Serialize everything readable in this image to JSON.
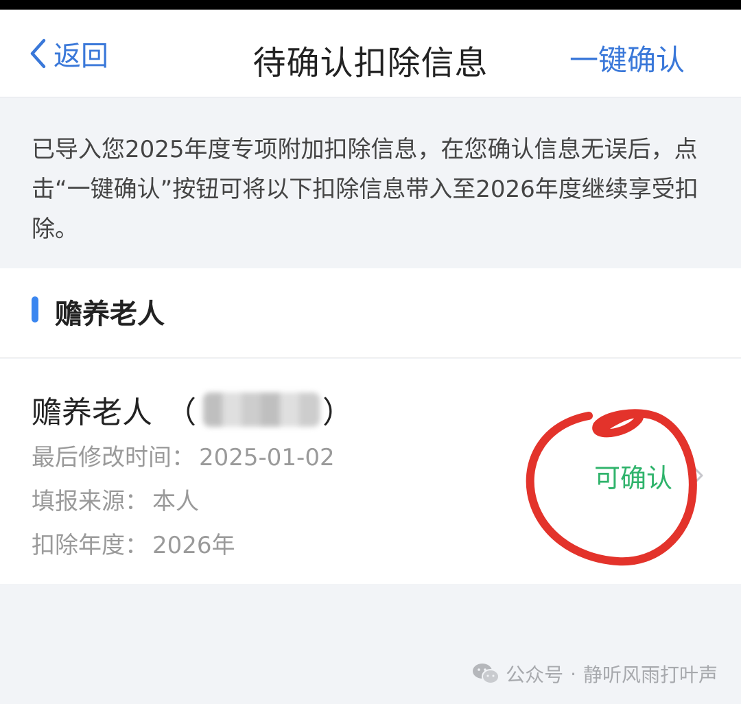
{
  "nav": {
    "back_label": "返回",
    "title": "待确认扣除信息",
    "confirm_all_label": "一键确认",
    "accent_color": "#3a78d9"
  },
  "notice": {
    "text": "已导入您2025年度专项附加扣除信息，在您确认信息无误后，点击“一键确认”按钮可将以下扣除信息带入至2026年度继续享受扣除。"
  },
  "section": {
    "title": "赡养老人",
    "indicator_color": "#3a86f0"
  },
  "card": {
    "title": "赡养老人",
    "paren_open": "（",
    "paren_close": "）",
    "modified_label": "最后修改时间：",
    "modified_value": "2025-01-02",
    "source_label": "填报来源：",
    "source_value": "本人",
    "year_label": "扣除年度：",
    "year_value": "2026年",
    "status": "可确认",
    "status_color": "#2fb36b"
  },
  "footer": {
    "account_label": "公众号",
    "separator": "·",
    "account_name": "静听风雨打叶声"
  },
  "icons": {
    "back": "chevron-left-icon",
    "chevron": "chevron-right-icon",
    "wechat": "wechat-icon"
  }
}
